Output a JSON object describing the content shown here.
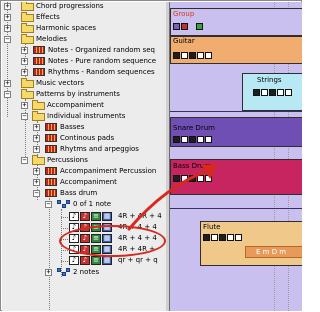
{
  "tree": {
    "items": [
      {
        "label": "Chord progressions"
      },
      {
        "label": "Effects"
      },
      {
        "label": "Harmonic spaces"
      },
      {
        "label": "Melodies"
      },
      {
        "label": "Notes - Organized random seq"
      },
      {
        "label": "Notes - Pure random sequence"
      },
      {
        "label": "Rhythms - Random sequences"
      },
      {
        "label": "Music vectors"
      },
      {
        "label": "Patterns by instruments"
      },
      {
        "label": "Accompaniment"
      },
      {
        "label": "Individual instruments"
      },
      {
        "label": "Basses"
      },
      {
        "label": "Continous pads"
      },
      {
        "label": "Rhytms and arpeggios"
      },
      {
        "label": "Percussions"
      },
      {
        "label": "Accompaniment Percussion"
      },
      {
        "label": "Accompaniment"
      },
      {
        "label": "Bass drum"
      },
      {
        "label": "0 of 1 note"
      },
      {
        "label": "4R + 4R + 4"
      },
      {
        "label": "4R + 4 + 4"
      },
      {
        "label": "4R + 4 + 4"
      },
      {
        "label": "4R + 4R +"
      },
      {
        "label": "qr + qr + q"
      },
      {
        "label": "2 notes"
      }
    ]
  },
  "arrangement": {
    "group_label": "Group",
    "tracks": [
      {
        "name": "Guitar"
      },
      {
        "name": "Strings"
      },
      {
        "name": "Snare Drum"
      },
      {
        "name": "Bass Drum"
      },
      {
        "name": "Flute"
      }
    ],
    "flute_clip": "E m D m"
  },
  "colors": {
    "annotation": "#d8291f",
    "lane_bg": "#c9c0f0",
    "guitar_clip": "#f1ac70",
    "strings_clip": "#b7e8f4",
    "snare_clip": "#6f4fb3",
    "bass_clip": "#c7255f",
    "flute_clip": "#f0c88a"
  }
}
